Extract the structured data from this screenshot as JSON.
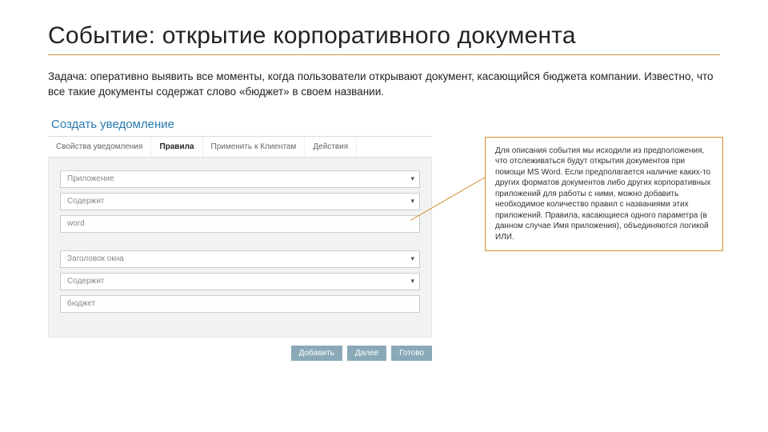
{
  "title": "Событие: открытие корпоративного документа",
  "task": "Задача: оперативно выявить все моменты, когда пользователи открывают документ, касающийся бюджета компании. Известно, что все такие документы содержат слово «бюджет» в своем названии.",
  "panel": {
    "heading": "Создать уведомление",
    "tabs": {
      "t0": "Свойства уведомления",
      "t1": "Правила",
      "t2": "Применить к Клиентам",
      "t3": "Действия"
    },
    "rule1": {
      "param": "Приложение",
      "cond": "Содержит",
      "value": "word"
    },
    "rule2": {
      "param": "Заголовок окна",
      "cond": "Содержит",
      "value": "бюджет"
    },
    "buttons": {
      "add": "Добавить",
      "next": "Далее",
      "done": "Готово"
    }
  },
  "callout": "Для описания события мы исходили из предположения, что отслеживаться будут открытия документов при помощи MS Word. Если предполагается наличие каких-то других форматов документов либо других корпоративных приложений для работы с ними, можно добавить необходимое количество правил с названиями этих приложений. Правила, касающиеся одного параметра (в данном случае Имя приложения), объединяются логикой ИЛИ."
}
